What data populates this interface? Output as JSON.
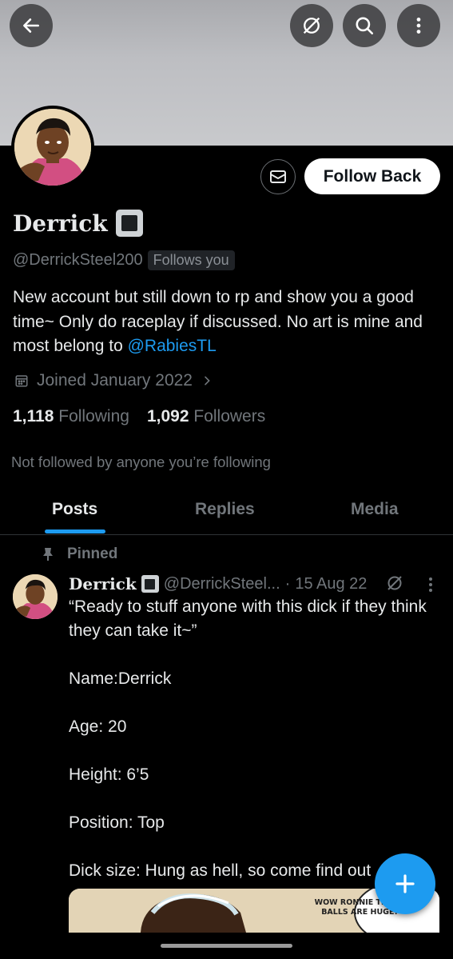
{
  "header": {
    "back_icon": "arrow-left-icon",
    "action_icons": [
      "muted-icon",
      "search-icon",
      "more-vertical-icon"
    ]
  },
  "profile": {
    "display_name": "Derrick",
    "handle": "@DerrickSteel200",
    "follows_you_badge": "Follows you",
    "follow_button": "Follow Back",
    "bio_text": "New account but still down to rp and show you a good time~ Only do raceplay if discussed. No art is mine and most belong to ",
    "bio_mention": "@RabiesTL",
    "joined": "Joined January 2022",
    "following_count": "1,118",
    "following_label": "Following",
    "followers_count": "1,092",
    "followers_label": "Followers",
    "not_followed_text": "Not followed by anyone you’re following"
  },
  "tabs": [
    {
      "label": "Posts",
      "active": true
    },
    {
      "label": "Replies",
      "active": false
    },
    {
      "label": "Media",
      "active": false
    }
  ],
  "pinned_post": {
    "pinned_label": "Pinned",
    "author_name": "Derrick",
    "author_handle": "@DerrickSteel...",
    "separator": "·",
    "date": "15 Aug 22",
    "lines": [
      "“Ready to stuff anyone with this dick if they think they can take it~”",
      "",
      "Name:Derrick",
      "",
      "Age: 20",
      "",
      "Height: 6’5",
      "",
      "Position: Top",
      "",
      "Dick size: Hung as hell, so come find out"
    ],
    "image_caption": "WOW RONNIE THOSE BALLS ARE HUGE!"
  },
  "fab_icon": "plus-icon",
  "colors": {
    "accent": "#1d9bf0",
    "background": "#000000",
    "muted_text": "#71767b"
  }
}
